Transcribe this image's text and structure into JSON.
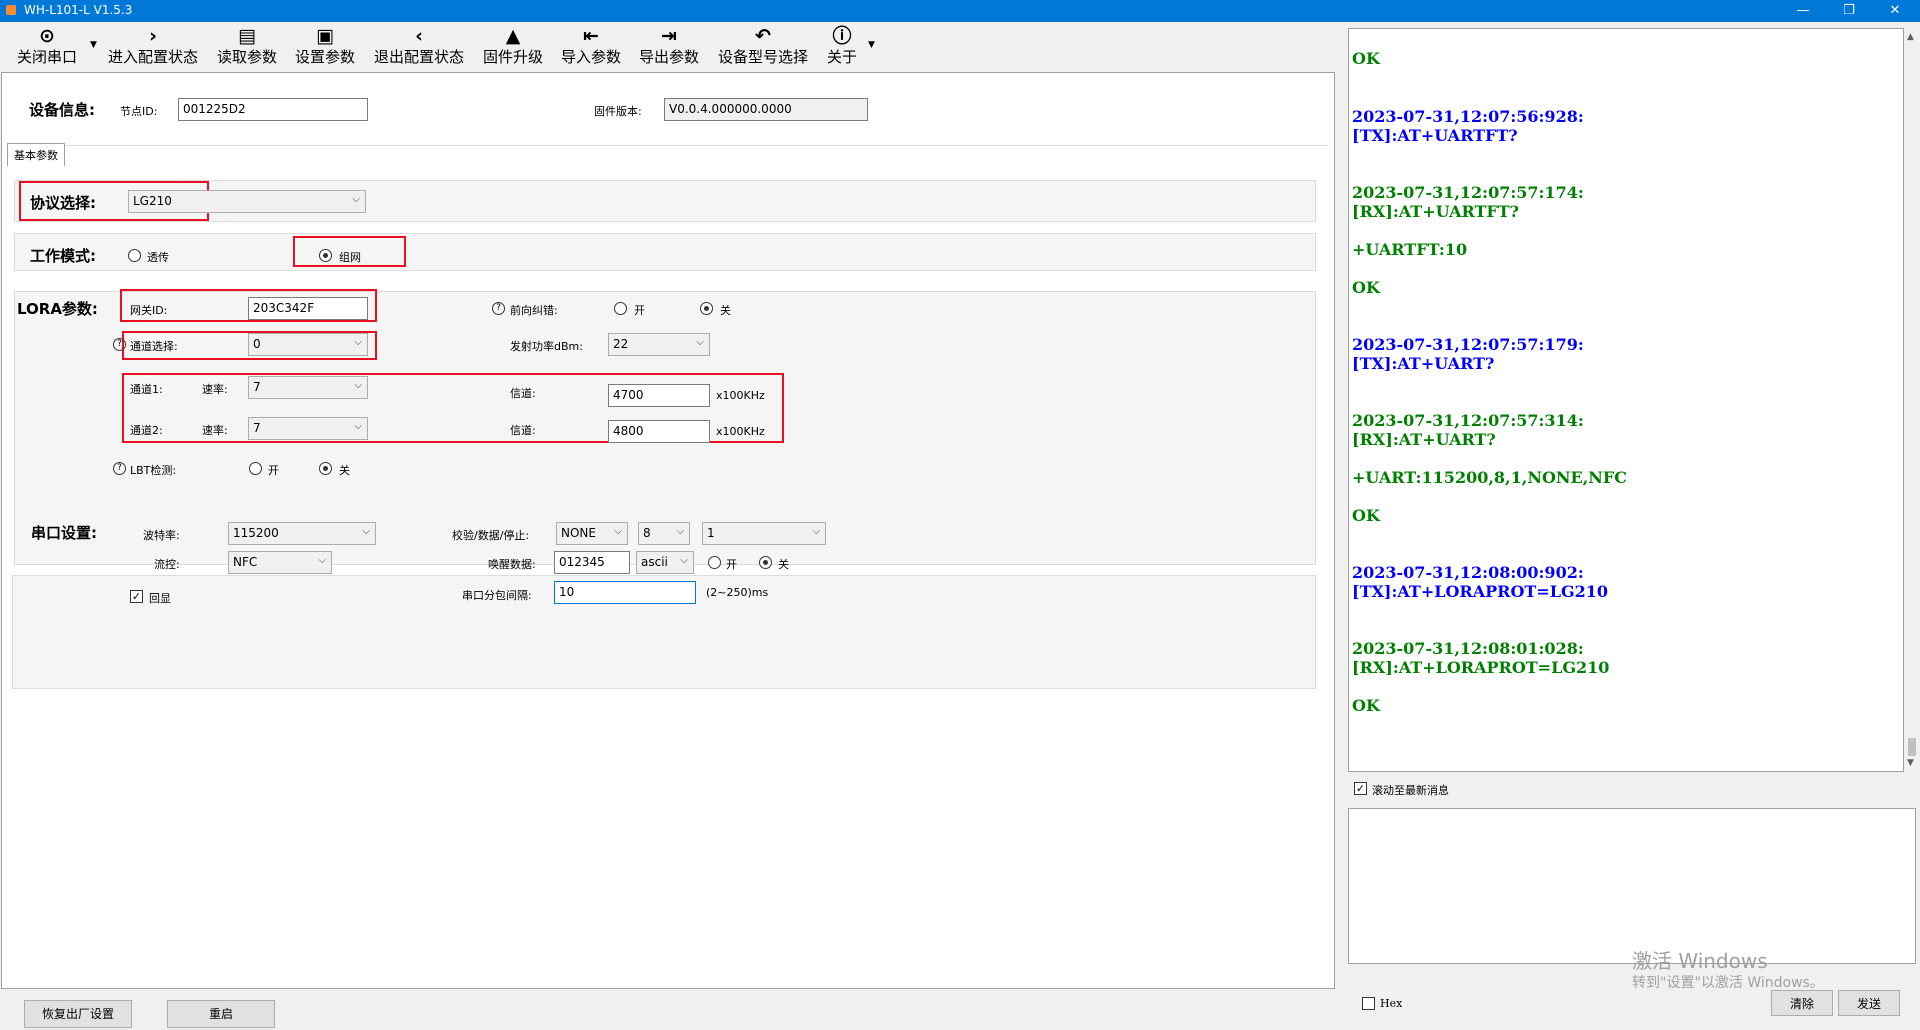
{
  "window": {
    "title": "WH-L101-L V1.5.3",
    "min": "—",
    "restore": "❐",
    "close": "✕"
  },
  "toolbar": {
    "close_port": "关闭串口",
    "enter_config": "进入配置状态",
    "read_params": "读取参数",
    "set_params": "设置参数",
    "exit_config": "退出配置状态",
    "firmware_upgrade": "固件升级",
    "import_params": "导入参数",
    "export_params": "导出参数",
    "device_model": "设备型号选择",
    "about": "关于"
  },
  "device_info": {
    "header": "设备信息:",
    "node_id_label": "节点ID:",
    "node_id_value": "001225D2",
    "firmware_label": "固件版本:",
    "firmware_value": "V0.0.4.000000.0000"
  },
  "tabs": {
    "basic": "基本参数"
  },
  "protocol": {
    "label": "协议选择:",
    "value": "LG210"
  },
  "work_mode": {
    "label": "工作模式:",
    "transparent": "透传",
    "network": "组网",
    "selected": "network"
  },
  "lora": {
    "header": "LORA参数:",
    "gateway_id_label": "网关ID:",
    "gateway_id_value": "203C342F",
    "fec_label": "前向纠错:",
    "fec_on": "开",
    "fec_off": "关",
    "channel_select_label": "通道选择:",
    "channel_select_value": "0",
    "tx_power_label": "发射功率dBm:",
    "tx_power_value": "22",
    "ch1_label": "通道1:",
    "ch1_rate_label": "速率:",
    "ch1_rate_value": "7",
    "ch1_freq_label": "信道:",
    "ch1_freq_value": "4700",
    "ch1_unit": "x100KHz",
    "ch2_label": "通道2:",
    "ch2_rate_label": "速率:",
    "ch2_rate_value": "7",
    "ch2_freq_label": "信道:",
    "ch2_freq_value": "4800",
    "ch2_unit": "x100KHz",
    "lbt_label": "LBT检测:",
    "lbt_on": "开",
    "lbt_off": "关"
  },
  "serial": {
    "header": "串口设置:",
    "baud_label": "波特率:",
    "baud_value": "115200",
    "parity_label": "校验/数据/停止:",
    "parity_value": "NONE",
    "data_bits_value": "8",
    "stop_bits_value": "1",
    "flow_label": "流控:",
    "flow_value": "NFC",
    "wake_label": "唤醒数据:",
    "wake_value": "012345",
    "wake_format": "ascii",
    "wake_on": "开",
    "wake_off": "关",
    "echo_label": "回显",
    "interval_label": "串口分包间隔:",
    "interval_value": "10",
    "interval_range": "(2~250)ms"
  },
  "bottom": {
    "factory_reset": "恢复出厂设置",
    "restart": "重启"
  },
  "log": [
    {
      "text": "OK",
      "color": "green"
    },
    {
      "text": "2023-07-31,12:07:56:928:",
      "color": "blue"
    },
    {
      "text": "[TX]:AT+UARTFT?",
      "color": "blue"
    },
    {
      "text": "2023-07-31,12:07:57:174:",
      "color": "green"
    },
    {
      "text": "[RX]:AT+UARTFT?",
      "color": "green"
    },
    {
      "text": "+UARTFT:10",
      "color": "green"
    },
    {
      "text": "OK",
      "color": "green"
    },
    {
      "text": "2023-07-31,12:07:57:179:",
      "color": "blue"
    },
    {
      "text": "[TX]:AT+UART?",
      "color": "blue"
    },
    {
      "text": "2023-07-31,12:07:57:314:",
      "color": "green"
    },
    {
      "text": "[RX]:AT+UART?",
      "color": "green"
    },
    {
      "text": "+UART:115200,8,1,NONE,NFC",
      "color": "green"
    },
    {
      "text": "OK",
      "color": "green"
    },
    {
      "text": "2023-07-31,12:08:00:902:",
      "color": "blue"
    },
    {
      "text": "[TX]:AT+LORAPROT=LG210",
      "color": "blue"
    },
    {
      "text": "2023-07-31,12:08:01:028:",
      "color": "green"
    },
    {
      "text": "[RX]:AT+LORAPROT=LG210",
      "color": "green"
    },
    {
      "text": "OK",
      "color": "green"
    }
  ],
  "right": {
    "autoscroll_label": "滚动至最新消息",
    "hex_label": "Hex",
    "clear": "清除",
    "send": "发送",
    "watermark_title": "激活 Windows",
    "watermark_sub": "转到\"设置\"以激活 Windows。"
  },
  "colors": {
    "green": "#008000",
    "blue": "#0000ff",
    "titlebar": "#0078d7",
    "highlight": "#e81123"
  }
}
